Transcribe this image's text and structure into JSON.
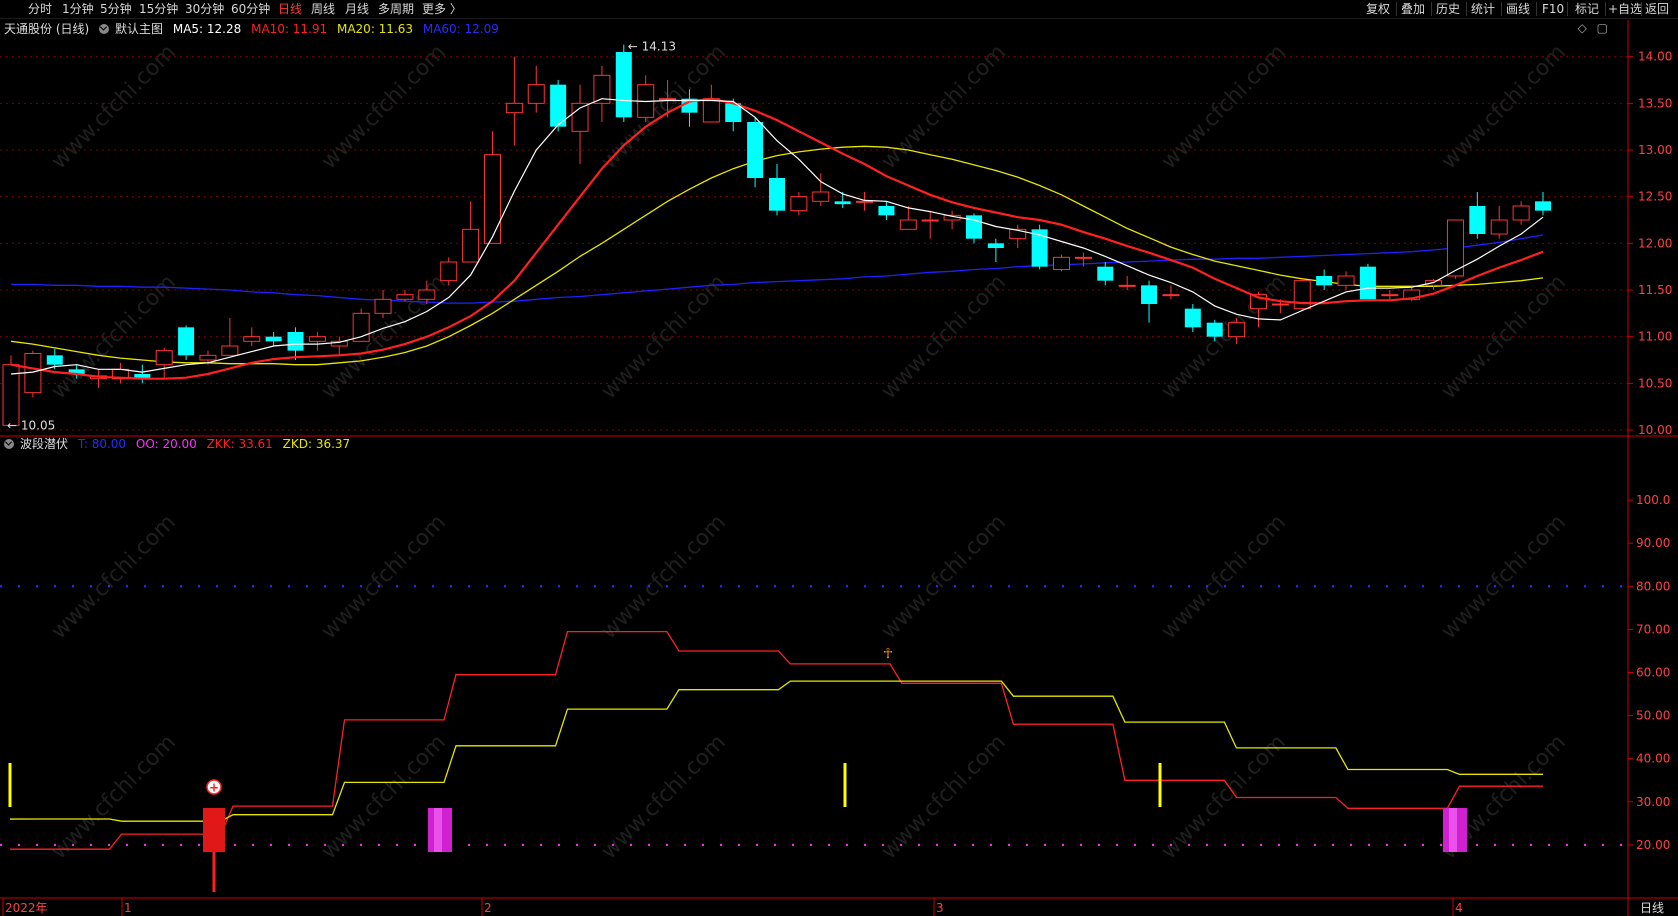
{
  "toolbar": {
    "left_items": [
      {
        "label": "分时"
      },
      {
        "label": "1分钟"
      },
      {
        "label": "5分钟"
      },
      {
        "label": "15分钟"
      },
      {
        "label": "30分钟"
      },
      {
        "label": "60分钟"
      },
      {
        "label": "日线",
        "active": true
      },
      {
        "label": "周线"
      },
      {
        "label": "月线"
      },
      {
        "label": "多周期"
      },
      {
        "label": "更多 〉"
      }
    ],
    "right_items": [
      {
        "label": "复权"
      },
      {
        "label": "叠加"
      },
      {
        "label": "历史"
      },
      {
        "label": "统计"
      },
      {
        "label": "画线"
      },
      {
        "label": "F10"
      },
      {
        "label": "标记"
      },
      {
        "label": "+自选"
      },
      {
        "label": "返回"
      }
    ]
  },
  "main_legend": {
    "stock": "天通股份 (日线)",
    "template": "默认主图",
    "ma5": "MA5: 12.28",
    "ma10": "MA10: 11.91",
    "ma20": "MA20: 11.63",
    "ma60": "MA60: 12.09"
  },
  "sub_legend": {
    "name": "波段潜伏",
    "t": "T: 80.00",
    "oo": "OO: 20.00",
    "zkk": "ZKK: 33.61",
    "zkd": "ZKD: 36.37"
  },
  "annotations": {
    "high": "14.13",
    "low": "10.05"
  },
  "price_axis": [
    "14.00",
    "13.50",
    "13.00",
    "12.50",
    "12.00",
    "11.50",
    "11.00",
    "10.50",
    "10.00"
  ],
  "ind_axis": [
    "100.0",
    "90.00",
    "80.00",
    "70.00",
    "60.00",
    "50.00",
    "40.00",
    "30.00",
    "20.00"
  ],
  "date_axis": [
    {
      "label": "2022年"
    },
    {
      "label": "1"
    },
    {
      "label": "2"
    },
    {
      "label": "3"
    },
    {
      "label": "4"
    }
  ],
  "period_label": "日线",
  "watermark": "www.cfchi.com",
  "colors": {
    "up": "#ff3232",
    "down": "#00ffff",
    "ma5": "#ffffff",
    "ma10": "#ff2020",
    "ma20": "#e6e600",
    "ma60": "#2020ff",
    "zkk": "#ff2020",
    "zkd": "#e6e600",
    "grid": "#7a0000",
    "axis": "#cc0000",
    "label": "#ff4040"
  },
  "chart_data": [
    {
      "type": "candlestick",
      "title": "天通股份 (日线)",
      "ylim": [
        9.95,
        14.25
      ],
      "candles": [
        [
          10.05,
          10.7,
          10.8,
          10.05
        ],
        [
          10.4,
          10.82,
          10.85,
          10.35
        ],
        [
          10.8,
          10.7,
          10.87,
          10.65
        ],
        [
          10.65,
          10.6,
          10.7,
          10.55
        ],
        [
          10.55,
          10.58,
          10.65,
          10.45
        ],
        [
          10.55,
          10.65,
          10.72,
          10.5
        ],
        [
          10.6,
          10.55,
          10.7,
          10.5
        ],
        [
          10.7,
          10.85,
          10.88,
          10.55
        ],
        [
          11.1,
          10.8,
          11.12,
          10.75
        ],
        [
          10.75,
          10.8,
          10.85,
          10.7
        ],
        [
          10.8,
          10.9,
          11.2,
          10.8
        ],
        [
          10.95,
          11.0,
          11.1,
          10.9
        ],
        [
          11.0,
          10.95,
          11.05,
          10.9
        ],
        [
          11.05,
          10.85,
          11.1,
          10.75
        ],
        [
          10.95,
          11.0,
          11.05,
          10.85
        ],
        [
          10.9,
          10.95,
          11.0,
          10.8
        ],
        [
          10.95,
          11.25,
          11.3,
          10.95
        ],
        [
          11.25,
          11.4,
          11.5,
          11.2
        ],
        [
          11.4,
          11.45,
          11.5,
          11.38
        ],
        [
          11.4,
          11.5,
          11.6,
          11.35
        ],
        [
          11.6,
          11.8,
          11.85,
          11.55
        ],
        [
          11.8,
          12.15,
          12.45,
          11.8
        ],
        [
          12.0,
          12.95,
          13.2,
          12.0
        ],
        [
          13.4,
          13.5,
          14.0,
          13.05
        ],
        [
          13.5,
          13.7,
          13.9,
          13.4
        ],
        [
          13.7,
          13.25,
          13.75,
          13.2
        ],
        [
          13.2,
          13.5,
          13.7,
          12.85
        ],
        [
          13.5,
          13.8,
          13.9,
          13.3
        ],
        [
          14.05,
          13.35,
          14.13,
          13.3
        ],
        [
          13.35,
          13.7,
          13.8,
          13.3
        ],
        [
          13.55,
          13.55,
          13.75,
          13.35
        ],
        [
          13.55,
          13.4,
          13.65,
          13.25
        ],
        [
          13.3,
          13.55,
          13.7,
          13.3
        ],
        [
          13.5,
          13.3,
          13.55,
          13.2
        ],
        [
          13.3,
          12.7,
          13.35,
          12.6
        ],
        [
          12.7,
          12.35,
          12.85,
          12.3
        ],
        [
          12.35,
          12.5,
          12.55,
          12.3
        ],
        [
          12.45,
          12.55,
          12.75,
          12.4
        ],
        [
          12.45,
          12.42,
          12.55,
          12.38
        ],
        [
          12.45,
          12.45,
          12.55,
          12.35
        ],
        [
          12.4,
          12.3,
          12.45,
          12.25
        ],
        [
          12.15,
          12.25,
          12.4,
          12.15
        ],
        [
          12.25,
          12.25,
          12.35,
          12.05
        ],
        [
          12.25,
          12.3,
          12.35,
          12.15
        ],
        [
          12.3,
          12.05,
          12.32,
          12.0
        ],
        [
          12.0,
          11.95,
          12.05,
          11.8
        ],
        [
          12.05,
          12.15,
          12.2,
          11.95
        ],
        [
          12.15,
          11.75,
          12.2,
          11.72
        ],
        [
          11.72,
          11.85,
          11.88,
          11.7
        ],
        [
          11.85,
          11.85,
          11.9,
          11.75
        ],
        [
          11.75,
          11.6,
          11.8,
          11.55
        ],
        [
          11.55,
          11.55,
          11.65,
          11.5
        ],
        [
          11.55,
          11.35,
          11.6,
          11.15
        ],
        [
          11.45,
          11.45,
          11.55,
          11.4
        ],
        [
          11.3,
          11.1,
          11.35,
          11.05
        ],
        [
          11.15,
          11.0,
          11.18,
          10.95
        ],
        [
          11.0,
          11.15,
          11.2,
          10.92
        ],
        [
          11.3,
          11.45,
          11.48,
          11.1
        ],
        [
          11.35,
          11.35,
          11.4,
          11.25
        ],
        [
          11.3,
          11.6,
          11.62,
          11.28
        ],
        [
          11.65,
          11.55,
          11.72,
          11.5
        ],
        [
          11.55,
          11.65,
          11.7,
          11.5
        ],
        [
          11.75,
          11.4,
          11.78,
          11.38
        ],
        [
          11.45,
          11.45,
          11.5,
          11.4
        ],
        [
          11.4,
          11.5,
          11.55,
          11.38
        ],
        [
          11.55,
          11.6,
          11.62,
          11.5
        ],
        [
          11.65,
          12.25,
          12.25,
          11.62
        ],
        [
          12.4,
          12.1,
          12.55,
          12.05
        ],
        [
          12.1,
          12.25,
          12.4,
          12.05
        ],
        [
          12.25,
          12.4,
          12.45,
          12.2
        ],
        [
          12.45,
          12.35,
          12.55,
          12.3
        ]
      ],
      "ma5": [
        10.6,
        10.62,
        10.68,
        10.7,
        10.65,
        10.65,
        10.62,
        10.66,
        10.7,
        10.72,
        10.78,
        10.84,
        10.9,
        10.92,
        10.92,
        10.94,
        11.0,
        11.09,
        11.16,
        11.27,
        11.42,
        11.66,
        12.07,
        12.56,
        13.0,
        13.27,
        13.45,
        13.55,
        13.53,
        13.52,
        13.53,
        13.53,
        13.53,
        13.52,
        13.35,
        13.1,
        12.9,
        12.66,
        12.53,
        12.46,
        12.45,
        12.38,
        12.34,
        12.29,
        12.25,
        12.18,
        12.14,
        12.09,
        12.02,
        11.95,
        11.86,
        11.76,
        11.66,
        11.58,
        11.48,
        11.33,
        11.24,
        11.19,
        11.18,
        11.28,
        11.38,
        11.48,
        11.52,
        11.52,
        11.53,
        11.58,
        11.71,
        11.83,
        11.97,
        12.1,
        12.28
      ],
      "ma10": [
        10.7,
        10.66,
        10.62,
        10.6,
        10.57,
        10.56,
        10.55,
        10.55,
        10.56,
        10.6,
        10.66,
        10.72,
        10.76,
        10.78,
        10.79,
        10.8,
        10.82,
        10.86,
        10.92,
        11.0,
        11.1,
        11.22,
        11.38,
        11.6,
        11.9,
        12.2,
        12.5,
        12.8,
        13.05,
        13.25,
        13.4,
        13.52,
        13.55,
        13.5,
        13.42,
        13.32,
        13.2,
        13.08,
        12.96,
        12.85,
        12.72,
        12.62,
        12.52,
        12.44,
        12.38,
        12.33,
        12.28,
        12.25,
        12.2,
        12.12,
        12.05,
        11.97,
        11.9,
        11.82,
        11.74,
        11.62,
        11.52,
        11.42,
        11.38,
        11.36,
        11.36,
        11.38,
        11.39,
        11.39,
        11.41,
        11.46,
        11.55,
        11.65,
        11.74,
        11.82,
        11.91
      ],
      "ma20": [
        10.95,
        10.92,
        10.88,
        10.84,
        10.8,
        10.77,
        10.75,
        10.73,
        10.72,
        10.72,
        10.71,
        10.71,
        10.71,
        10.7,
        10.7,
        10.72,
        10.74,
        10.78,
        10.83,
        10.9,
        11.0,
        11.12,
        11.25,
        11.4,
        11.55,
        11.7,
        11.86,
        12.0,
        12.15,
        12.3,
        12.45,
        12.58,
        12.7,
        12.8,
        12.88,
        12.94,
        12.98,
        13.01,
        13.03,
        13.04,
        13.03,
        13.0,
        12.95,
        12.9,
        12.84,
        12.78,
        12.71,
        12.62,
        12.52,
        12.4,
        12.28,
        12.16,
        12.06,
        11.96,
        11.88,
        11.81,
        11.76,
        11.71,
        11.66,
        11.62,
        11.59,
        11.56,
        11.54,
        11.54,
        11.54,
        11.54,
        11.55,
        11.56,
        11.58,
        11.6,
        11.63
      ],
      "ma60": [
        11.56,
        11.56,
        11.55,
        11.55,
        11.54,
        11.54,
        11.53,
        11.53,
        11.52,
        11.51,
        11.5,
        11.48,
        11.47,
        11.45,
        11.44,
        11.42,
        11.4,
        11.39,
        11.38,
        11.37,
        11.36,
        11.36,
        11.37,
        11.38,
        11.4,
        11.42,
        11.43,
        11.45,
        11.47,
        11.49,
        11.51,
        11.53,
        11.55,
        11.56,
        11.58,
        11.59,
        11.6,
        11.61,
        11.62,
        11.64,
        11.65,
        11.67,
        11.69,
        11.7,
        11.72,
        11.73,
        11.75,
        11.76,
        11.77,
        11.78,
        11.79,
        11.8,
        11.81,
        11.82,
        11.83,
        11.83,
        11.84,
        11.84,
        11.85,
        11.86,
        11.87,
        11.88,
        11.89,
        11.9,
        11.91,
        11.93,
        11.95,
        11.98,
        12.01,
        12.05,
        12.09
      ]
    },
    {
      "type": "line",
      "title": "波段潜伏",
      "ylim": [
        0,
        104
      ],
      "series": [
        {
          "name": "ZKK",
          "values": [
            19,
            19,
            19,
            19,
            22.5,
            22.5,
            22.5,
            22.5,
            29,
            29,
            29,
            29,
            49,
            49,
            49,
            49,
            59.5,
            59.5,
            59.5,
            59.5,
            69.5,
            69.5,
            69.5,
            69.5,
            65,
            65,
            65,
            65,
            62,
            62,
            62,
            62,
            57.5,
            57.5,
            57.5,
            57.5,
            48,
            48,
            48,
            48,
            35,
            35,
            35,
            35,
            31,
            31,
            31,
            31,
            28.5,
            28.5,
            28.5,
            28.5,
            33.61,
            33.61,
            33.61,
            33.61
          ]
        },
        {
          "name": "ZKD",
          "values": [
            26,
            26,
            26,
            26,
            25.5,
            25.5,
            25.5,
            25.5,
            27,
            27,
            27,
            27,
            34.5,
            34.5,
            34.5,
            34.5,
            43,
            43,
            43,
            43,
            51.5,
            51.5,
            51.5,
            51.5,
            56,
            56,
            56,
            56,
            58,
            58,
            58,
            58,
            58,
            58,
            58,
            58,
            54.5,
            54.5,
            54.5,
            54.5,
            48.5,
            48.5,
            48.5,
            48.5,
            42.5,
            42.5,
            42.5,
            42.5,
            37.5,
            37.5,
            37.5,
            37.5,
            36.37,
            36.37,
            36.37,
            36.37
          ]
        }
      ],
      "T": 80,
      "OO": 20
    }
  ]
}
